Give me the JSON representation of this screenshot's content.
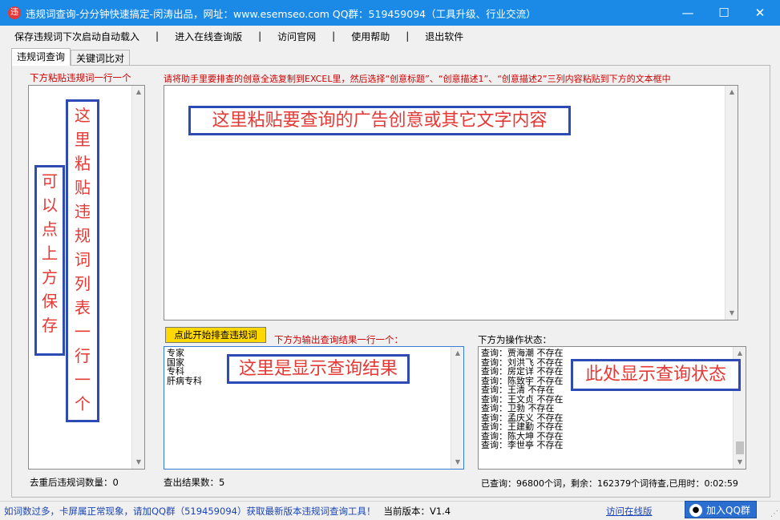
{
  "titlebar": {
    "app_icon": "违",
    "title": "违规词查询-分分钟快速搞定-闵涛出品，网址：www.esemseo.com QQ群：519459094（工具升级、行业交流）",
    "minimize": "—",
    "maximize": "☐",
    "close": "✕"
  },
  "menu": {
    "items": [
      "保存违规词下次启动自动载入",
      "进入在线查询版",
      "访问官网",
      "使用帮助",
      "退出软件"
    ],
    "separator": "|"
  },
  "tabs": [
    "违规词查询",
    "关键词比对"
  ],
  "left": {
    "label": "下方粘贴违规词一行一个",
    "callout_paste": "这里粘贴违规词列表一行一个",
    "callout_save": "可以点上方保存",
    "count_label": "去重后违规词数量：0"
  },
  "creative": {
    "instruction": "请将助手里要排查的创意全选复制到EXCEL里，然后选择“创意标题”、“创意描述1”、“创意描述2”三列内容粘贴到下方的文本框中",
    "callout": "这里粘贴要查询的广告创意或其它文字内容"
  },
  "results": {
    "button": "点此开始排查违规词",
    "label": "下方为输出查询结果一行一个：",
    "lines": [
      "专家",
      "国家",
      "专科",
      "肝病专科"
    ],
    "callout": "这里是显示查询结果",
    "count_label": "查出结果数：5"
  },
  "status": {
    "label": "下方为操作状态：",
    "lines": [
      "查询：贾海潮 不存在",
      "查询：刘洪飞 不存在",
      "查询：房定详 不存在",
      "查询：陈致宇 不存在",
      "查询：王清 不存在",
      "查询：王文贞 不存在",
      "查询：卫勃 不存在",
      "查询：孟庆义 不存在",
      "查询：王建勤 不存在",
      "查询：陈大坤 不存在",
      "查询：李世亭 不存在"
    ],
    "callout": "此处显示查询状态",
    "summary": "已查询：96800个词，剩余：162379个词待查,已用时：0:02:59"
  },
  "statusbar": {
    "tip": "如词数过多，卡屏属正常现象，请加QQ群（519459094）获取最新版本违规词查询工具！",
    "version": "当前版本：V1.4",
    "online_link": "访问在线版",
    "qq_button": "加入QQ群",
    "qq_icon": "people-icon"
  }
}
